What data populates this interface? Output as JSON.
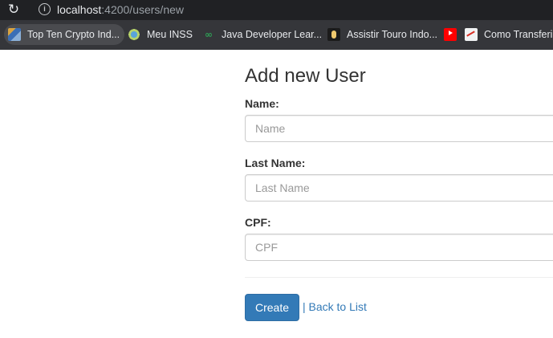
{
  "browser": {
    "url_host": "localhost",
    "url_path": ":4200/users/new",
    "bookmarks": [
      {
        "label": "Top Ten Crypto Ind...",
        "icon": "crypto-favicon-icon"
      },
      {
        "label": "Meu INSS",
        "icon": "inss-favicon-icon"
      },
      {
        "label": "Java Developer Lear...",
        "icon": "java-favicon-icon"
      },
      {
        "label": "Assistir Touro Indo...",
        "icon": "touro-favicon-icon"
      },
      {
        "label": "",
        "icon": "youtube-icon"
      },
      {
        "label": "Como Transferir...",
        "icon": "chart-favicon-icon"
      }
    ]
  },
  "form": {
    "title": "Add new User",
    "fields": [
      {
        "label": "Name:",
        "placeholder": "Name",
        "value": ""
      },
      {
        "label": "Last Name:",
        "placeholder": "Last Name",
        "value": ""
      },
      {
        "label": "CPF:",
        "placeholder": "CPF",
        "value": ""
      }
    ],
    "create_label": "Create",
    "separator": "|",
    "back_label": "Back to List"
  },
  "colors": {
    "primary": "#337ab7",
    "chrome_dark": "#202124",
    "bookmarks_bar": "#35363a"
  }
}
